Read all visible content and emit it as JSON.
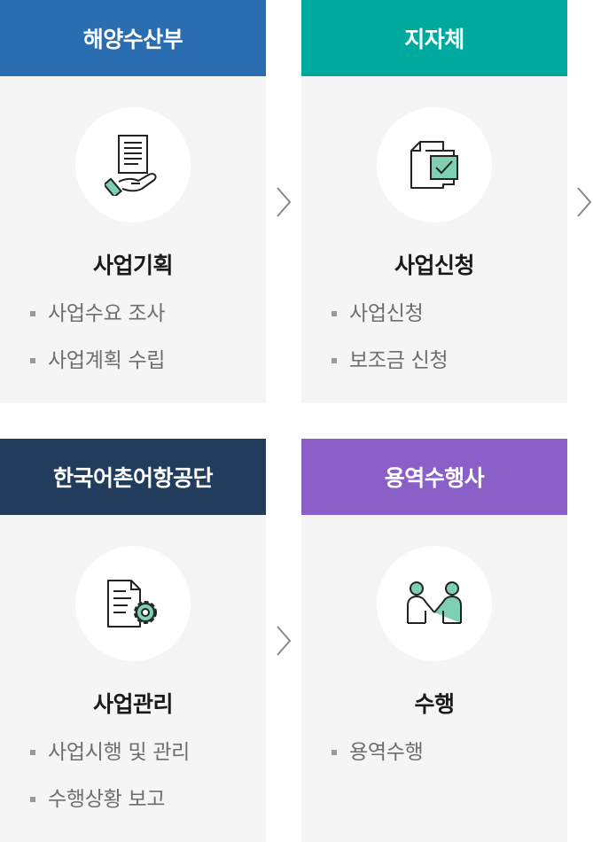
{
  "colors": {
    "mof": "#2a6db0",
    "local": "#00a99d",
    "fira": "#213c5c",
    "contractor": "#8a5fc8",
    "icon_accent": "#7fcfb3"
  },
  "cards": [
    {
      "header": "해양수산부",
      "icon": "document-hand-icon",
      "title": "사업기획",
      "items": [
        "사업수요 조사",
        "사업계획 수립"
      ]
    },
    {
      "header": "지자체",
      "icon": "document-check-icon",
      "title": "사업신청",
      "items": [
        "사업신청",
        "보조금 신청"
      ]
    },
    {
      "header": "한국어촌어항공단",
      "icon": "document-gear-icon",
      "title": "사업관리",
      "items": [
        "사업시행 및 관리",
        "수행상황 보고"
      ]
    },
    {
      "header": "용역수행사",
      "icon": "handshake-icon",
      "title": "수행",
      "items": [
        "용역수행"
      ]
    }
  ]
}
